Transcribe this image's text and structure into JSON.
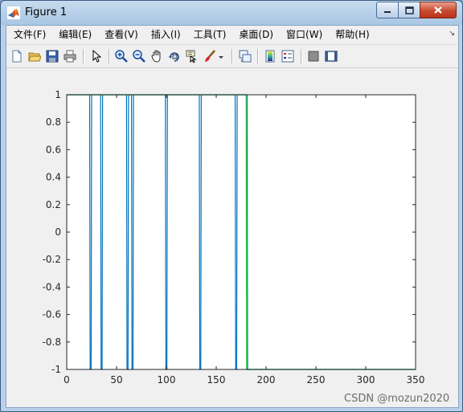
{
  "window": {
    "title": "Figure 1"
  },
  "menubar": {
    "items": [
      "文件(F)",
      "编辑(E)",
      "查看(V)",
      "插入(I)",
      "工具(T)",
      "桌面(D)",
      "窗口(W)",
      "帮助(H)"
    ]
  },
  "toolbar": {
    "buttons": [
      "new-figure-icon",
      "open-file-icon",
      "save-icon",
      "print-icon",
      "edit-plot-arrow-icon",
      "zoom-in-icon",
      "zoom-out-icon",
      "pan-hand-icon",
      "rotate-3d-icon",
      "data-cursor-icon",
      "brush-icon",
      "brush-dropdown-icon",
      "link-plot-icon",
      "colorbar-icon",
      "legend-icon",
      "hide-plot-tools-icon",
      "show-plot-tools-icon"
    ]
  },
  "watermark": "CSDN @mozun2020",
  "chart_data": {
    "type": "line",
    "xlim": [
      0,
      350
    ],
    "ylim": [
      -1,
      1
    ],
    "xticks": [
      0,
      50,
      100,
      150,
      200,
      250,
      300,
      350
    ],
    "yticks": [
      1,
      0.8,
      0.6,
      0.4,
      0.2,
      0,
      -0.2,
      -0.4,
      -0.6,
      -0.8,
      -1
    ],
    "xtick_labels": [
      "0",
      "50",
      "100",
      "150",
      "200",
      "250",
      "300",
      "350"
    ],
    "ytick_labels": [
      "1",
      "0.8",
      "0.6",
      "0.4",
      "0.2",
      "0",
      "-0.2",
      "-0.4",
      "-0.6",
      "-0.8",
      "-1"
    ],
    "grid": false,
    "series": [
      {
        "color": "#0072bd",
        "x": [
          0,
          23,
          23.5,
          24.5,
          25,
          34,
          34.5,
          35.5,
          36,
          60,
          60.5,
          61.5,
          62,
          65,
          65.5,
          66.5,
          67,
          99,
          99.5,
          100.5,
          101,
          133,
          133.5,
          134.5,
          135,
          169,
          169.5,
          170.5,
          171,
          181,
          181.5,
          350
        ],
        "y": [
          1,
          1,
          -1,
          -1,
          1,
          1,
          -1,
          -1,
          1,
          1,
          -1,
          -1,
          1,
          1,
          -1,
          -1,
          1,
          1,
          -1,
          -1,
          1,
          1,
          -1,
          -1,
          1,
          1,
          -1,
          -1,
          1,
          1,
          -1,
          -1
        ]
      },
      {
        "color": "#22cc22",
        "x": [
          0,
          180,
          180.5,
          350
        ],
        "y": [
          1,
          1,
          -1,
          -1
        ]
      }
    ]
  }
}
